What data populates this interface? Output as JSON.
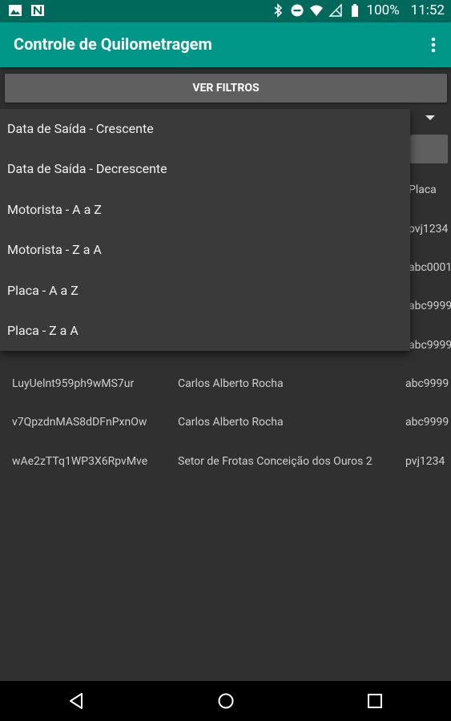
{
  "status_bar": {
    "battery": "100%",
    "time": "11:52"
  },
  "app_bar": {
    "title": "Controle de Quilometragem",
    "menu_icon": "more-vert-icon"
  },
  "filters_button": {
    "label": "VER FILTROS"
  },
  "sort_menu": {
    "items": [
      "Data de Saída - Crescente",
      "Data de Saída - Decrescente",
      "Motorista - A a Z",
      "Motorista - Z a A",
      "Placa - A a Z",
      "Placa - Z a A"
    ]
  },
  "table": {
    "header_placa": "Placa",
    "hidden_placas": [
      "pvj1234",
      "abc0001",
      "abc9999",
      "abc9999"
    ],
    "rows": [
      {
        "id": "LuyUelnt959ph9wMS7ur",
        "motorista": "Carlos Alberto Rocha",
        "placa": "abc9999"
      },
      {
        "id": "v7QpzdnMAS8dDFnPxnOw",
        "motorista": "Carlos Alberto Rocha",
        "placa": "abc9999"
      },
      {
        "id": "wAe2zTTq1WP3X6RpvMve",
        "motorista": "Setor de Frotas Conceição dos Ouros 2",
        "placa": "pvj1234"
      }
    ]
  }
}
